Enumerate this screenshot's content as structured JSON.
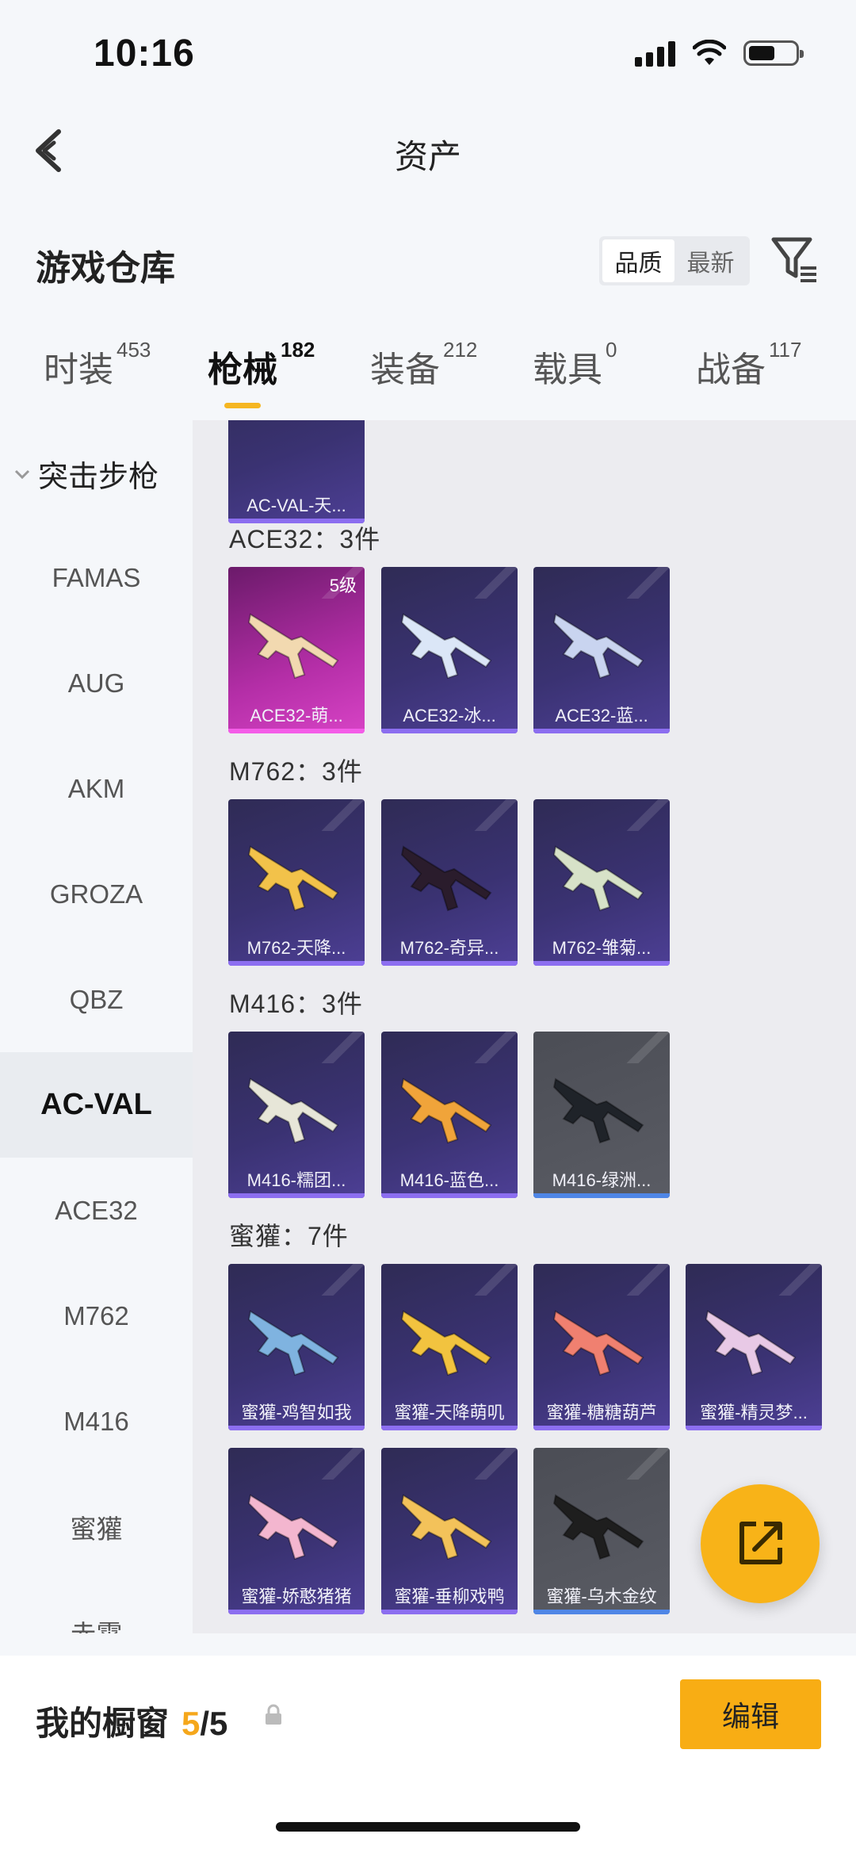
{
  "status_bar": {
    "time": "10:16"
  },
  "nav": {
    "title": "资产"
  },
  "header": {
    "title": "游戏仓库",
    "sort_options": [
      "品质",
      "最新"
    ],
    "sort_selected": "品质"
  },
  "tabs": [
    {
      "label": "时装",
      "count": "453"
    },
    {
      "label": "枪械",
      "count": "182"
    },
    {
      "label": "装备",
      "count": "212"
    },
    {
      "label": "载具",
      "count": "0"
    },
    {
      "label": "战备",
      "count": "117"
    }
  ],
  "active_tab": "枪械",
  "sidebar": {
    "group": "突击步枪",
    "items": [
      "FAMAS",
      "AUG",
      "AKM",
      "GROZA",
      "QBZ",
      "AC-VAL",
      "ACE32",
      "M762",
      "M416",
      "蜜獾",
      "赤霄"
    ],
    "active": "AC-VAL"
  },
  "content": {
    "top_card": {
      "name": "AC-VAL-天..."
    },
    "groups": [
      {
        "label": "ACE32：3件",
        "items": [
          {
            "name": "ACE32-萌...",
            "level": "5级",
            "rarity": "pink"
          },
          {
            "name": "ACE32-冰...",
            "level": "",
            "rarity": "purple"
          },
          {
            "name": "ACE32-蓝...",
            "level": "",
            "rarity": "purple"
          }
        ]
      },
      {
        "label": "M762：3件",
        "items": [
          {
            "name": "M762-天降...",
            "level": "",
            "rarity": "purple"
          },
          {
            "name": "M762-奇异...",
            "level": "",
            "rarity": "purple"
          },
          {
            "name": "M762-雏菊...",
            "level": "",
            "rarity": "purple"
          }
        ]
      },
      {
        "label": "M416：3件",
        "items": [
          {
            "name": "M416-糯团...",
            "level": "",
            "rarity": "purple"
          },
          {
            "name": "M416-蓝色...",
            "level": "",
            "rarity": "purple"
          },
          {
            "name": "M416-绿洲...",
            "level": "",
            "rarity": "grey"
          }
        ]
      },
      {
        "label": "蜜獾：7件",
        "items": [
          {
            "name": "蜜獾-鸡智如我",
            "level": "",
            "rarity": "purple"
          },
          {
            "name": "蜜獾-天降萌叽",
            "level": "",
            "rarity": "purple"
          },
          {
            "name": "蜜獾-糖糖葫芦",
            "level": "",
            "rarity": "purple"
          },
          {
            "name": "蜜獾-精灵梦...",
            "level": "",
            "rarity": "purple"
          },
          {
            "name": "蜜獾-娇憨猪猪",
            "level": "",
            "rarity": "purple"
          },
          {
            "name": "蜜獾-垂柳戏鸭",
            "level": "",
            "rarity": "purple"
          },
          {
            "name": "蜜獾-乌木金纹",
            "level": "",
            "rarity": "grey"
          }
        ]
      }
    ]
  },
  "showcase": {
    "title": "我的橱窗",
    "count_current": "5",
    "count_sep_total": "/5",
    "edit_label": "编辑"
  },
  "colors": {
    "accent": "#f8ad14",
    "highlight": "#f5a71b"
  }
}
